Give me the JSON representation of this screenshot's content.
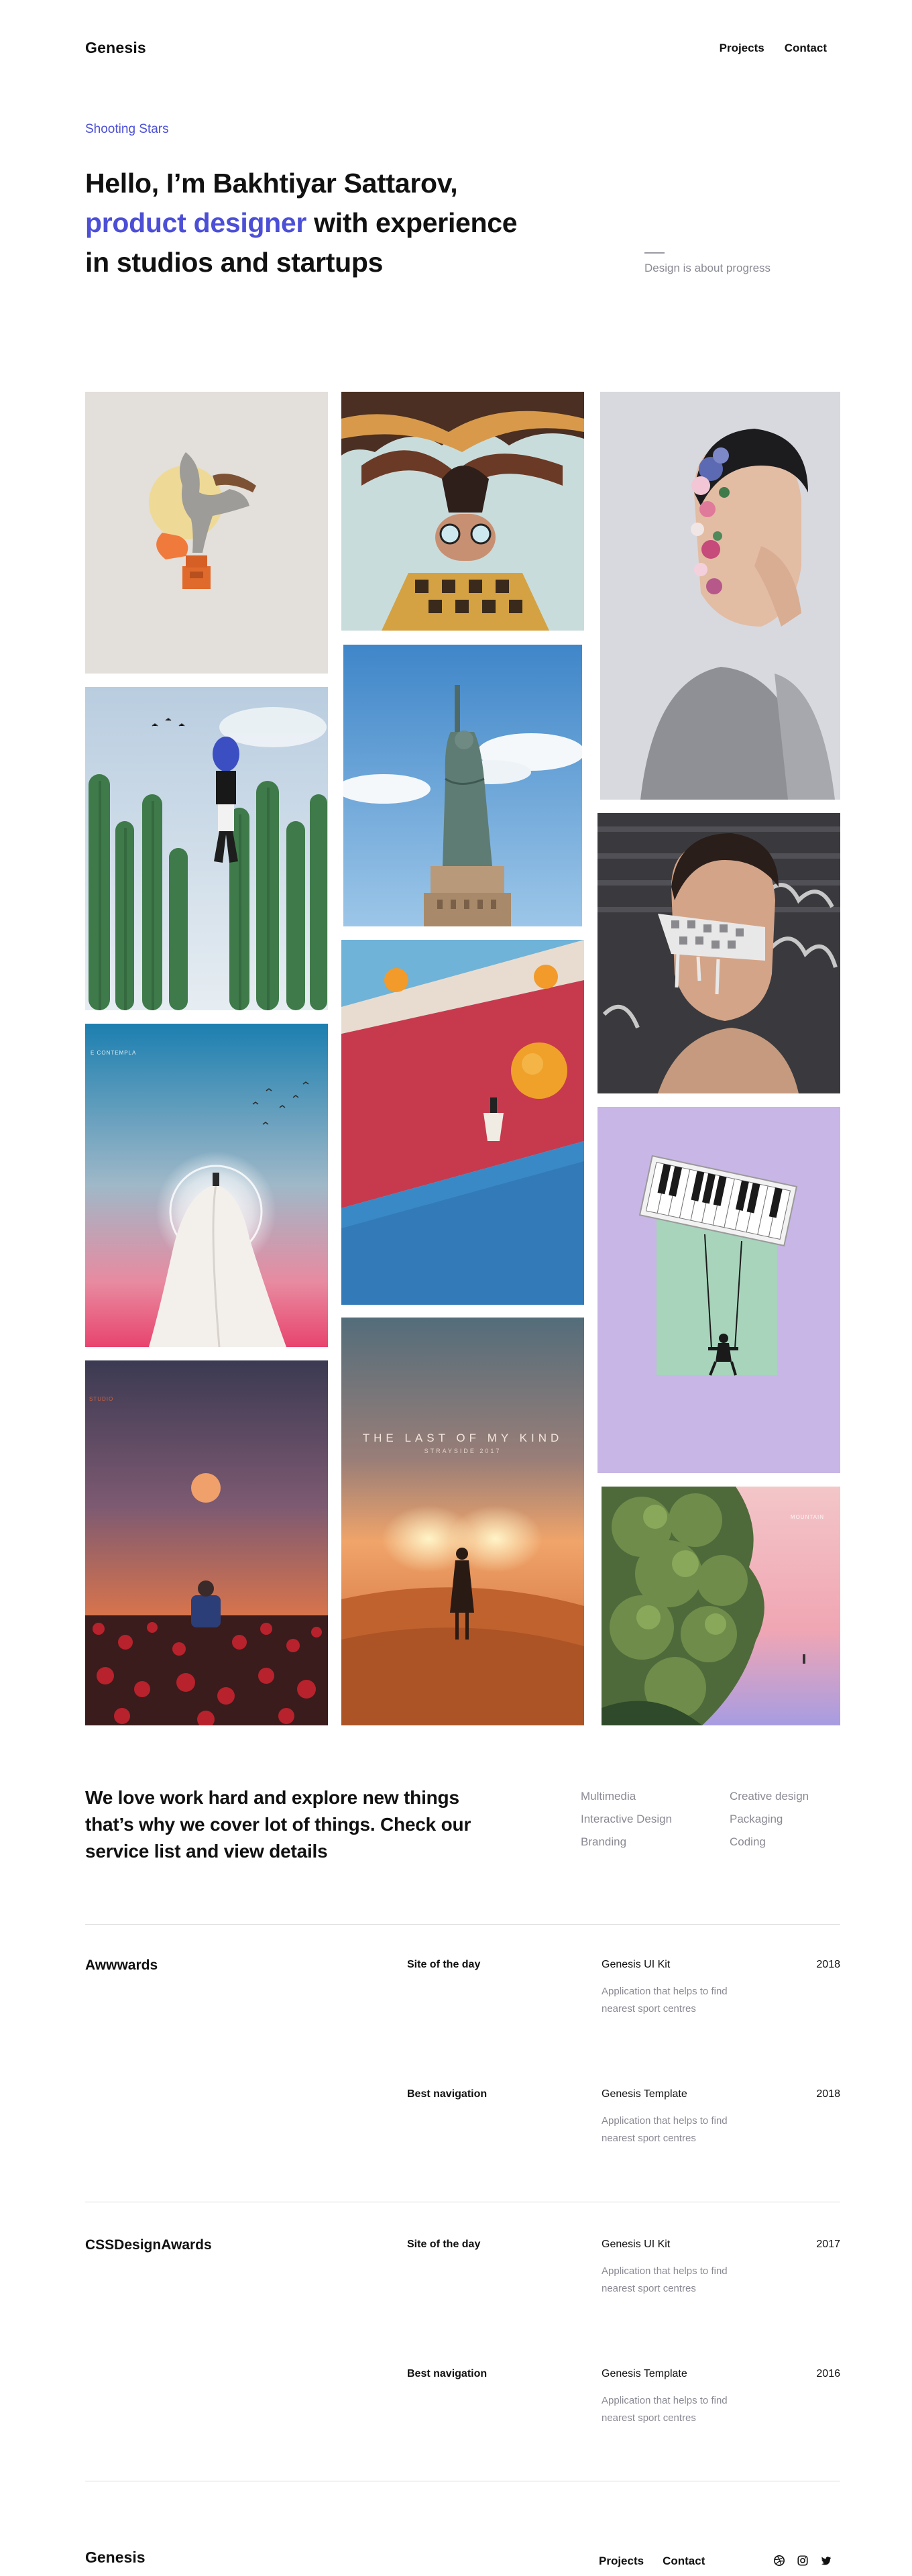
{
  "header": {
    "logo": "Genesis",
    "nav": [
      {
        "label": "Projects"
      },
      {
        "label": "Contact"
      }
    ]
  },
  "hero": {
    "eyebrow": "Shooting Stars",
    "title_line1": "Hello, I’m Bakhtiyar Sattarov,",
    "title_highlight": "product designer",
    "title_rest": " with experience",
    "title_line3": "in studios and startups",
    "tagline": "Design is about progress"
  },
  "gallery": {
    "poster_title": "THE LAST OF MY KIND",
    "poster_sub": "STRAYSIDE 2017",
    "corner_label_1": "E CONTEMPLA",
    "corner_label_2": "STUDIO",
    "corner_label_3": "MOUNTAIN"
  },
  "services": {
    "text": "We love work hard and explore new things that’s why we cover lot of things. Check our service list and view details",
    "items": [
      "Multimedia",
      "Creative design",
      "Interactive Design",
      "Packaging",
      "Branding",
      "Coding"
    ]
  },
  "awards": [
    {
      "org": "Awwwards",
      "entries": [
        {
          "category": "Site of the day",
          "project": "Genesis UI Kit",
          "desc": "Application that helps to find nearest sport centres",
          "year": "2018"
        },
        {
          "category": "Best navigation",
          "project": "Genesis Template",
          "desc": "Application that helps to find nearest sport centres",
          "year": "2018"
        }
      ]
    },
    {
      "org": "CSSDesignAwards",
      "entries": [
        {
          "category": "Site of the day",
          "project": "Genesis UI Kit",
          "desc": "Application that helps to find nearest sport centres",
          "year": "2017"
        },
        {
          "category": "Best navigation",
          "project": "Genesis Template",
          "desc": "Application that helps to find nearest sport centres",
          "year": "2016"
        }
      ]
    }
  ],
  "footer": {
    "logo": "Genesis",
    "nav": [
      {
        "label": "Projects"
      },
      {
        "label": "Contact"
      }
    ],
    "social": [
      {
        "icon": "dribbble-icon"
      },
      {
        "icon": "instagram-icon"
      },
      {
        "icon": "twitter-icon"
      }
    ]
  },
  "colors": {
    "accent": "#4c4fd6",
    "text": "#111111",
    "muted": "#8a8a94",
    "rule": "#dadada"
  }
}
